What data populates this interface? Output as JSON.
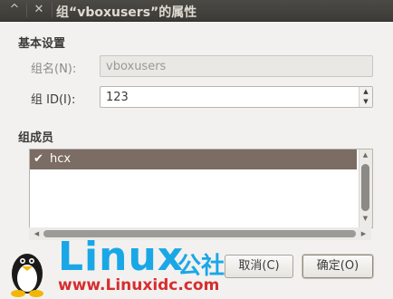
{
  "window": {
    "title": "组“vboxusers”的属性",
    "titlebar_buttons": {
      "minimize_icon": "^",
      "close_icon": "✕"
    }
  },
  "basic_settings": {
    "heading": "基本设置",
    "group_name": {
      "label": "组名(N):",
      "value": "vboxusers",
      "disabled": true
    },
    "group_id": {
      "label": "组 ID(I):",
      "value": "123",
      "spin_up": "▲",
      "spin_down": "▼"
    }
  },
  "members": {
    "heading": "组成员",
    "items": [
      {
        "name": "hcx",
        "checked": true,
        "check_glyph": "✔"
      }
    ]
  },
  "buttons": {
    "cancel": "取消(C)",
    "ok": "确定(O)"
  },
  "watermark": {
    "brand": "Linux",
    "brand_cjk": "公社",
    "url": "www.Linuxidc.com"
  },
  "colors": {
    "titlebar": "#3c3b37",
    "selection": "#7b6c64",
    "window_bg": "#f2f1f0",
    "logo_blue": "#1aa7e6",
    "logo_red": "#d62e2e"
  }
}
